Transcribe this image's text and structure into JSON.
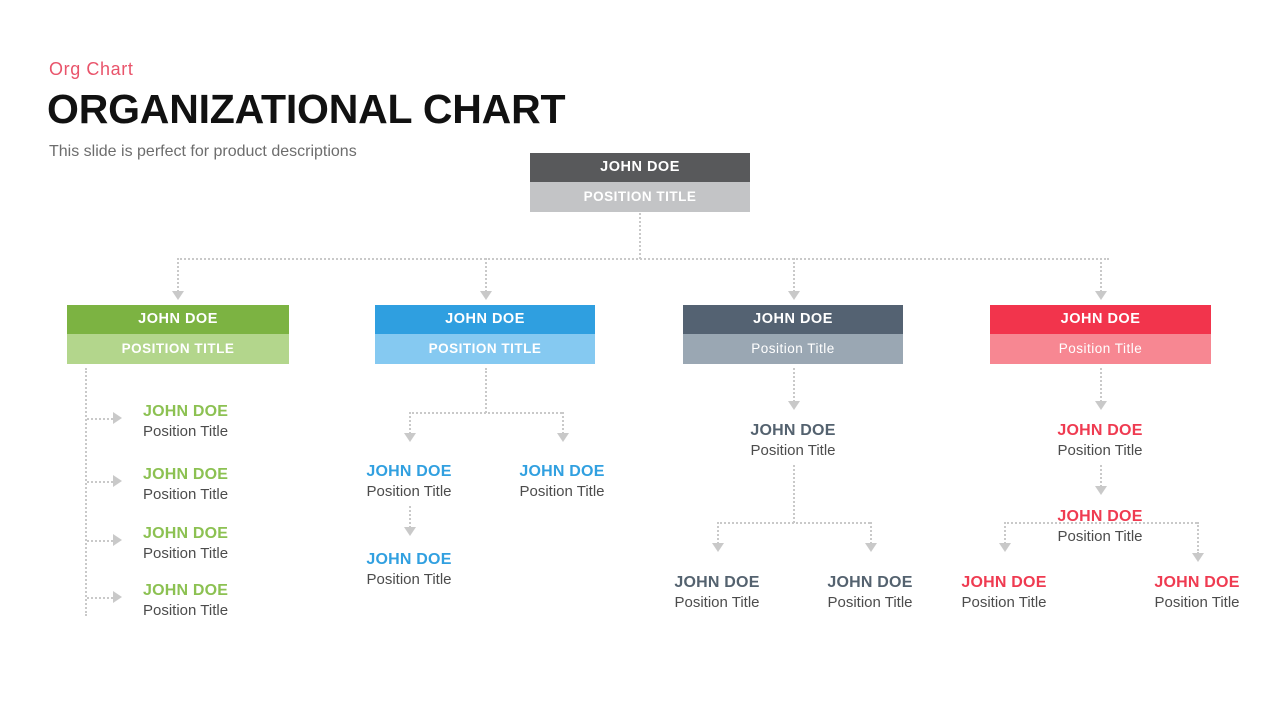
{
  "header": {
    "kicker": "Org  Chart",
    "title": "ORGANIZATIONAL CHART",
    "subtitle": "This slide is perfect for product descriptions"
  },
  "colors": {
    "kicker": "#e9546b",
    "title": "#111111",
    "subtitle": "#6d6d6d",
    "connector": "#c9c9c9",
    "root_head": "#58595b",
    "root_body": "#c3c4c6",
    "green_head": "#7cb342",
    "green_body": "#b3d68c",
    "blue_head": "#2f9fe0",
    "blue_body": "#85c9f1",
    "slate_head": "#546272",
    "slate_body": "#9aa7b3",
    "red_head": "#f2344c",
    "red_body": "#f78792",
    "green_text": "#8cc152",
    "blue_text": "#31a0e0",
    "slate_text": "#54626f",
    "red_text": "#ef3b51",
    "leaf_title_text": "#4c4c4c"
  },
  "chart_data": {
    "type": "diagram",
    "title": "ORGANIZATIONAL CHART",
    "root": {
      "name": "JOHN DOE",
      "title": "POSITION TITLE",
      "children": 4
    },
    "branches": [
      {
        "accent": "green",
        "children": 4,
        "depth": 2
      },
      {
        "accent": "blue",
        "children": 2,
        "depth": 3
      },
      {
        "accent": "slate",
        "children": 1,
        "depth": 3
      },
      {
        "accent": "red",
        "children": 1,
        "depth": 4
      }
    ]
  },
  "root": {
    "name": "JOHN DOE",
    "title": "POSITION TITLE"
  },
  "branches": {
    "green": {
      "box": {
        "name": "JOHN DOE",
        "title": "POSITION TITLE"
      },
      "items": [
        {
          "name": "JOHN DOE",
          "title": "Position Title"
        },
        {
          "name": "JOHN DOE",
          "title": "Position Title"
        },
        {
          "name": "JOHN DOE",
          "title": "Position Title"
        },
        {
          "name": "JOHN DOE",
          "title": "Position Title"
        }
      ]
    },
    "blue": {
      "box": {
        "name": "JOHN DOE",
        "title": "POSITION TITLE"
      },
      "items": [
        {
          "name": "JOHN DOE",
          "title": "Position Title"
        },
        {
          "name": "JOHN DOE",
          "title": "Position Title"
        },
        {
          "name": "JOHN DOE",
          "title": "Position Title"
        }
      ]
    },
    "slate": {
      "box": {
        "name": "JOHN DOE",
        "title": "Position Title"
      },
      "items": [
        {
          "name": "JOHN DOE",
          "title": "Position Title"
        },
        {
          "name": "JOHN DOE",
          "title": "Position Title"
        },
        {
          "name": "JOHN DOE",
          "title": "Position Title"
        }
      ]
    },
    "red": {
      "box": {
        "name": "JOHN DOE",
        "title": "Position Title"
      },
      "items": [
        {
          "name": "JOHN DOE",
          "title": "Position Title"
        },
        {
          "name": "JOHN DOE",
          "title": "Position Title"
        },
        {
          "name": "JOHN DOE",
          "title": "Position Title"
        },
        {
          "name": "JOHN DOE",
          "title": "Position Title"
        }
      ]
    }
  }
}
